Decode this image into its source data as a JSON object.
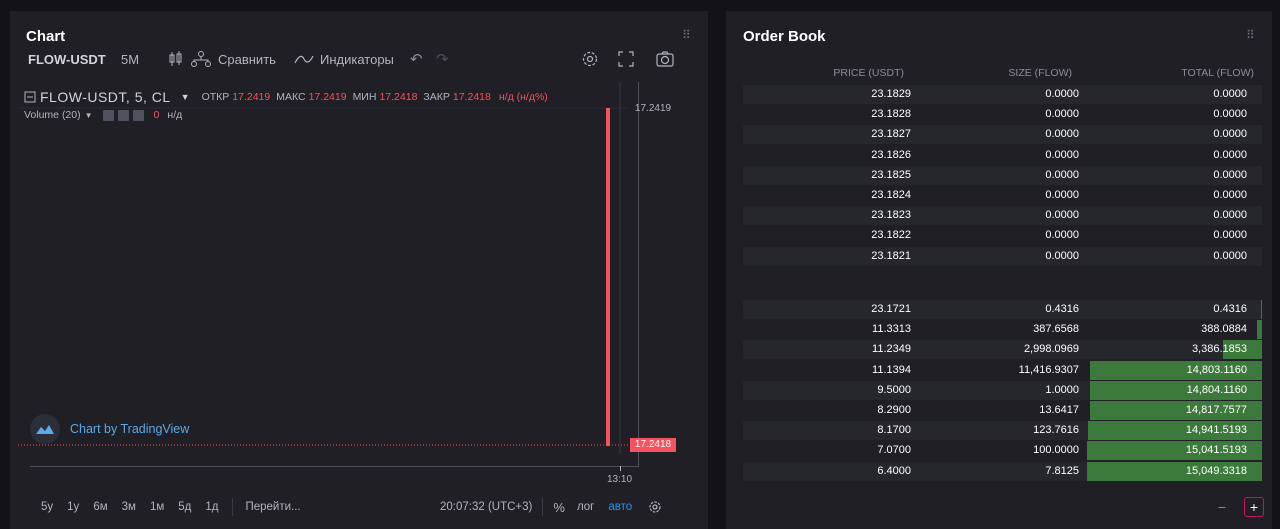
{
  "chart_panel": {
    "title": "Chart",
    "toolbar": {
      "symbol": "FLOW-USDT",
      "interval": "5M",
      "compare_label": "Сравнить",
      "indicators_label": "Индикаторы"
    },
    "legend": {
      "symbol": "FLOW-USDT, 5, CL",
      "open_label": "ОТКР",
      "open_value": "17.2419",
      "high_label": "МАКС",
      "high_value": "17.2419",
      "low_label": "МИН",
      "low_value": "17.2418",
      "close_label": "ЗАКР",
      "close_value": "17.2418",
      "change": "н/д (н/д%)"
    },
    "volume": {
      "label": "Volume (20)",
      "value": "0",
      "suffix": "н/д"
    },
    "price_labels": {
      "top": "17.2419",
      "current": "17.2418"
    },
    "time_label": "13:10",
    "watermark": "Chart by TradingView",
    "ranges": [
      "5y",
      "1y",
      "6м",
      "3м",
      "1м",
      "5д",
      "1д"
    ],
    "goto_label": "Перейти...",
    "clock": "20:07:32 (UTC+3)",
    "percent_label": "%",
    "log_label": "лог",
    "auto_label": "авто",
    "colors": {
      "down": "#f7525f",
      "accent": "#2196f3"
    }
  },
  "order_book": {
    "title": "Order Book",
    "headers": {
      "price": "PRICE (USDT)",
      "size": "SIZE (FLOW)",
      "total": "TOTAL (FLOW)"
    },
    "asks": [
      {
        "price": "23.1829",
        "size": "0.0000",
        "total": "0.0000"
      },
      {
        "price": "23.1828",
        "size": "0.0000",
        "total": "0.0000"
      },
      {
        "price": "23.1827",
        "size": "0.0000",
        "total": "0.0000"
      },
      {
        "price": "23.1826",
        "size": "0.0000",
        "total": "0.0000"
      },
      {
        "price": "23.1825",
        "size": "0.0000",
        "total": "0.0000"
      },
      {
        "price": "23.1824",
        "size": "0.0000",
        "total": "0.0000"
      },
      {
        "price": "23.1823",
        "size": "0.0000",
        "total": "0.0000"
      },
      {
        "price": "23.1822",
        "size": "0.0000",
        "total": "0.0000"
      },
      {
        "price": "23.1821",
        "size": "0.0000",
        "total": "0.0000"
      }
    ],
    "bids": [
      {
        "price": "23.1721",
        "size": "0.4316",
        "total": "0.4316",
        "depth": 0.0003
      },
      {
        "price": "11.3313",
        "size": "387.6568",
        "total": "388.0884",
        "depth": 0.026
      },
      {
        "price": "11.2349",
        "size": "2,998.0969",
        "total": "3,386.1853",
        "depth": 0.225
      },
      {
        "price": "11.1394",
        "size": "11,416.9307",
        "total": "14,803.1160",
        "depth": 0.984
      },
      {
        "price": "9.5000",
        "size": "1.0000",
        "total": "14,804.1160",
        "depth": 0.984
      },
      {
        "price": "8.2900",
        "size": "13.6417",
        "total": "14,817.7577",
        "depth": 0.985
      },
      {
        "price": "8.1700",
        "size": "123.7616",
        "total": "14,941.5193",
        "depth": 0.993
      },
      {
        "price": "7.0700",
        "size": "100.0000",
        "total": "15,041.5193",
        "depth": 0.9995
      },
      {
        "price": "6.4000",
        "size": "7.8125",
        "total": "15,049.3318",
        "depth": 1.0
      }
    ],
    "bid_color": "#3c7a3c"
  }
}
